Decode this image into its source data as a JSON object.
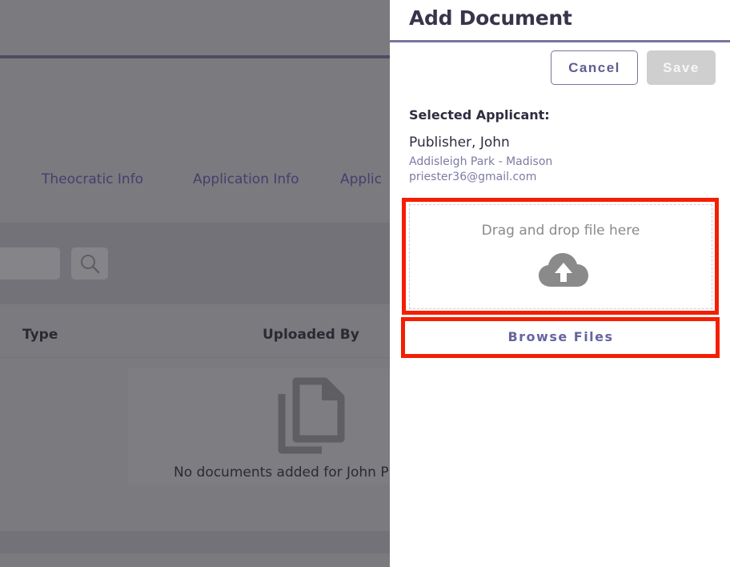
{
  "background": {
    "tabs": [
      "Theocratic Info",
      "Application Info",
      "Applic"
    ],
    "table": {
      "columns": [
        "Type",
        "Uploaded By"
      ],
      "empty_message": "No documents added for John P"
    }
  },
  "drawer": {
    "title": "Add Document",
    "cancel_label": "Cancel",
    "save_label": "Save",
    "selected_applicant": {
      "label": "Selected Applicant:",
      "name": "Publisher, John",
      "location": "Addisleigh Park - Madison",
      "email": "priester36@gmail.com"
    },
    "drop_zone": {
      "text": "Drag and drop file here",
      "icon": "cloud-upload-icon"
    },
    "browse_label": "Browse Files"
  },
  "colors": {
    "accent": "#6664a0",
    "title": "#37354a",
    "highlight": "#f51e00",
    "overlay": "#7b7a7e"
  }
}
